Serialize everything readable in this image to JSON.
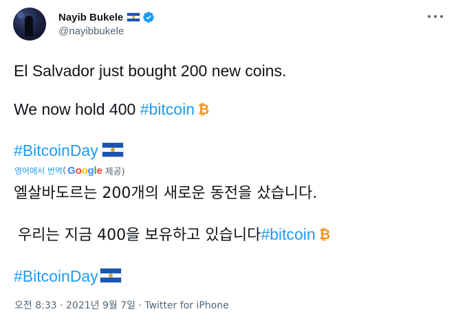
{
  "author": {
    "name": "Nayib Bukele",
    "handle": "@nayibbukele",
    "verified_icon": "verified-badge-icon",
    "flag_icon": "el-salvador-flag-icon"
  },
  "tweet": {
    "line1": "El Salvador just bought 200 new coins.",
    "line2_text": "We now hold 400 ",
    "line2_hashtag": "#bitcoin",
    "line3_hashtag": "#BitcoinDay"
  },
  "translation": {
    "link_label": "영어에서 번역",
    "open_paren": "(",
    "provider_letters": [
      "G",
      "o",
      "o",
      "g",
      "l",
      "e"
    ],
    "provided_by": "제공)",
    "line1": "엘살바도르는 200개의 새로운 동전을 샀습니다.",
    "line2_text": "우리는 지금 400을 보유하고 있습니다",
    "line2_hashtag": "#bitcoin",
    "line3_hashtag": "#BitcoinDay"
  },
  "meta": {
    "time": "오전 8:33",
    "separator": " · ",
    "date": "2021년 9월 7일",
    "source": "Twitter for iPhone"
  },
  "colors": {
    "link": "#1d9bf0",
    "secondary_text": "#536471",
    "bitcoin": "#f7931a",
    "flag_blue": "#1a55b4"
  },
  "icons": {
    "more": "more-options-icon",
    "bitcoin": "bitcoin-icon"
  }
}
